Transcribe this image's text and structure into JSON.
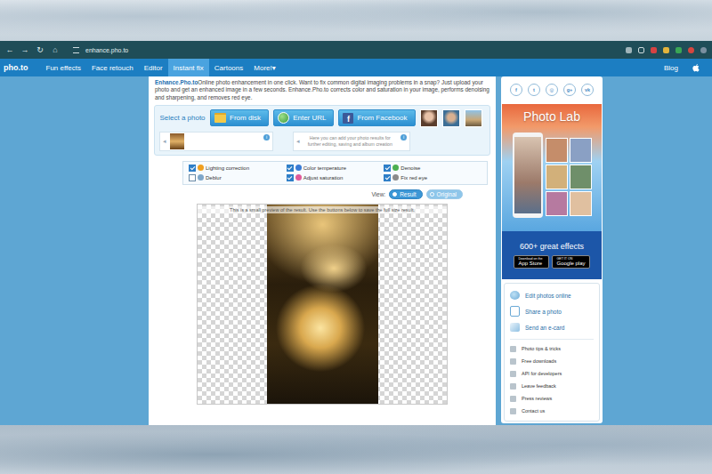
{
  "browser": {
    "controls": [
      "←",
      "→",
      "↻",
      "⌂"
    ],
    "url": "enhance.pho.to"
  },
  "nav": {
    "logo": "pho.to",
    "items": [
      {
        "label": "Fun effects",
        "selected": false
      },
      {
        "label": "Face retouch",
        "selected": false
      },
      {
        "label": "Editor",
        "selected": false
      },
      {
        "label": "Instant fix",
        "selected": true
      },
      {
        "label": "Cartoons",
        "selected": false
      },
      {
        "label": "More!▾",
        "selected": false
      }
    ],
    "right": "Blog"
  },
  "intro": {
    "title": "Enhance.Pho.to",
    "text": "Online photo enhancement in one click. Want to fix common digital imaging problems in a snap? Just upload your photo and get an enhanced image in a few seconds. Enhance.Pho.to corrects color and saturation in your image, performs denoising and sharpening, and removes red eye."
  },
  "picker": {
    "label": "Select a photo",
    "buttons": [
      {
        "label": "From disk",
        "kind": "disk"
      },
      {
        "label": "Enter URL",
        "kind": "url"
      },
      {
        "label": "From Facebook",
        "kind": "facebook",
        "glyph": "f"
      }
    ],
    "arrow": "◂",
    "info": "i",
    "hint": "Here you can add your photo results for further editing, saving and album creation"
  },
  "options": [
    {
      "label": "Lighting correction",
      "checked": true,
      "color": "#f0a020"
    },
    {
      "label": "Color temperature",
      "checked": true,
      "color": "#3a7bd5"
    },
    {
      "label": "Denoise",
      "checked": true,
      "color": "#4caf50"
    },
    {
      "label": "Deblur",
      "checked": false,
      "color": "#7fa7c9"
    },
    {
      "label": "Adjust saturation",
      "checked": true,
      "color": "#e05a9a"
    },
    {
      "label": "Fix red eye",
      "checked": true,
      "color": "#8a8a8a"
    }
  ],
  "view": {
    "label": "View:",
    "options": [
      {
        "label": "Result",
        "selected": true
      },
      {
        "label": "Original",
        "selected": false
      }
    ]
  },
  "preview": {
    "note": "This is a small preview of the result. Use the buttons below to save the full size result."
  },
  "sidebar": {
    "social": [
      "f",
      "t",
      "◎",
      "g+",
      "vk"
    ],
    "ad": {
      "title": "Photo Lab",
      "tagline": "600+ great effects",
      "badges": [
        {
          "small": "Download on the",
          "big": "App Store"
        },
        {
          "small": "GET IT ON",
          "big": "Google play"
        }
      ]
    },
    "links": [
      {
        "label": "Edit photos online",
        "kind": "edit"
      },
      {
        "label": "Share a photo",
        "kind": "share"
      },
      {
        "label": "Send an e-card",
        "kind": "card"
      }
    ],
    "small_links": [
      "Photo tips & tricks",
      "Free downloads",
      "API for developers",
      "Leave feedback",
      "Press reviews",
      "Contact us"
    ]
  }
}
